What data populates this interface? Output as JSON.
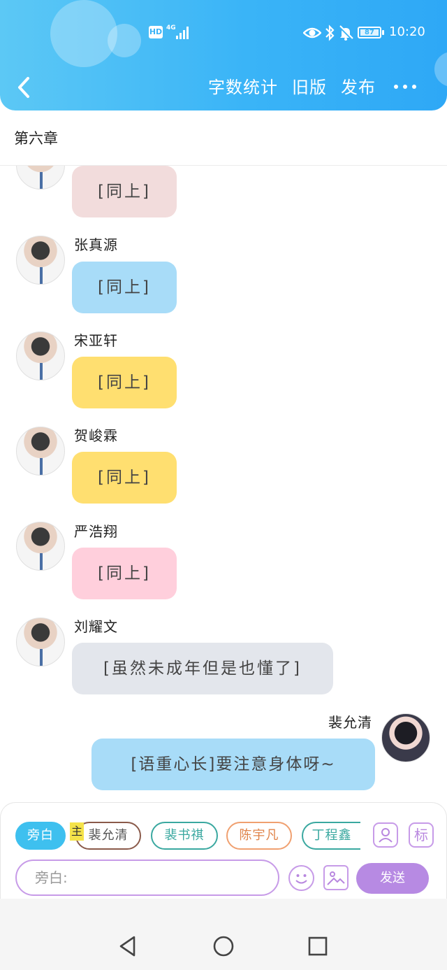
{
  "status_bar": {
    "hd": "HD",
    "network": "4G",
    "battery": "87",
    "time": "10:20",
    "icons": [
      "eye-icon",
      "bluetooth-icon",
      "mute-bell-icon"
    ]
  },
  "header": {
    "back_icon": "chevron-left-icon",
    "word_count": "字数统计",
    "old_version": "旧版",
    "publish": "发布",
    "more_icon": "more-dots-icon",
    "colors": {
      "start": "#5cc8f5",
      "end": "#2ea8f6"
    }
  },
  "chapter": {
    "title": "第六章"
  },
  "messages": [
    {
      "name": "",
      "text": "[同上]",
      "color": "#f2dcdc",
      "side": "left"
    },
    {
      "name": "张真源",
      "text": "[同上]",
      "color": "#a8dcf8",
      "side": "left"
    },
    {
      "name": "宋亚轩",
      "text": "[同上]",
      "color": "#ffdf70",
      "side": "left"
    },
    {
      "name": "贺峻霖",
      "text": "[同上]",
      "color": "#ffdf70",
      "side": "left"
    },
    {
      "name": "严浩翔",
      "text": "[同上]",
      "color": "#ffcfdc",
      "side": "left"
    },
    {
      "name": "刘耀文",
      "text": "[虽然未成年但是也懂了]",
      "color": "#e3e6ec",
      "side": "left"
    },
    {
      "name": "裴允清",
      "text": "[语重心长]要注意身体呀~",
      "color": "#a8dcf8",
      "side": "right"
    }
  ],
  "composer": {
    "narration_chip": "旁白",
    "main_tag": "主",
    "characters": [
      {
        "label": "裴允清",
        "color": "#8a5a4a"
      },
      {
        "label": "裴书祺",
        "color": "#3aa8a0"
      },
      {
        "label": "陈宇凡",
        "color": "#f0a070"
      },
      {
        "label": "丁程鑫",
        "color": "#3aa8a0"
      }
    ],
    "tag_button": "标",
    "input_placeholder": "旁白:",
    "send": "发送",
    "icons": [
      "person-icon",
      "emoji-icon",
      "image-icon"
    ]
  },
  "system_nav": {
    "icons": [
      "back-triangle-icon",
      "home-circle-icon",
      "recents-square-icon"
    ]
  }
}
